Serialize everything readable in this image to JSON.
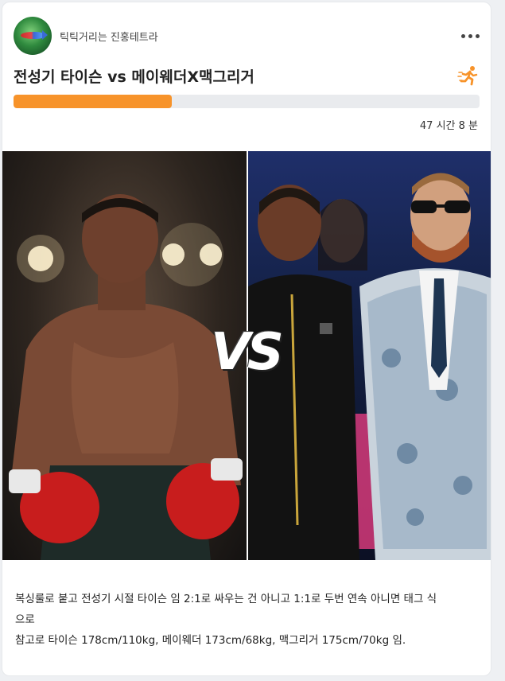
{
  "post": {
    "author": "틱틱거리는 진홍테트라",
    "title": "전성기 타이슨 vs 메이웨더X맥그리거",
    "progress_fraction": 0.34,
    "time_left": "47 시간 8 분",
    "image_overlay_text": "VS",
    "description_lines": [
      "복싱룰로 붙고 전성기 시절 타이슨 임 2:1로 싸우는 건 아니고 1:1로 두번 연속 아니면 태그 식",
      "으로",
      "참고로 타이슨 178cm/110kg, 메이웨더 173cm/68kg, 맥그리거 175cm/70kg 임."
    ]
  },
  "icons": {
    "more": "more-dots-icon",
    "run": "running-person-icon"
  },
  "colors": {
    "accent": "#f7932a",
    "progress_track": "#e9ebee",
    "card_bg": "#ffffff",
    "page_bg": "#eef0f3"
  }
}
